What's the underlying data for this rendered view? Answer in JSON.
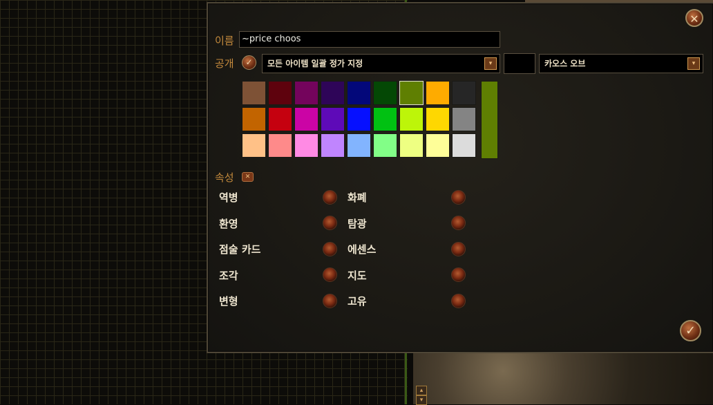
{
  "filter_editor": {
    "name_label": "이름",
    "name_value": "~price  choos",
    "public_label": "공개",
    "pricing_dropdown": "모든 아이템 일괄 정가 지정",
    "currency_dropdown": "카오스 오브",
    "attributes_label": "속성",
    "close_glyph": "✕",
    "confirm_glyph": "✓",
    "dropdown_arrow": "▾",
    "toggle_glyph": "✓",
    "badge_glyph": "✕",
    "selected_color": "#5f7f02",
    "palette": [
      [
        "#7e5236",
        "#5e020d",
        "#74045c",
        "#2e0558",
        "#03087a",
        "#044805",
        "#5f7f02",
        "#feab00",
        "#262626"
      ],
      [
        "#c26400",
        "#c5010f",
        "#cb04a5",
        "#5e0ab8",
        "#0610ff",
        "#01c112",
        "#bdf509",
        "#fed701",
        "#848484"
      ],
      [
        "#ffc187",
        "#fe8a8a",
        "#ff8ae4",
        "#c085fe",
        "#82b4fe",
        "#82fe87",
        "#eeff82",
        "#fefe98",
        "#dcdcdc"
      ]
    ],
    "categories_left": [
      "역병",
      "환영",
      "점술 카드",
      "조각",
      "변형"
    ],
    "categories_right": [
      "화폐",
      "탐광",
      "에센스",
      "지도",
      "고유"
    ]
  }
}
